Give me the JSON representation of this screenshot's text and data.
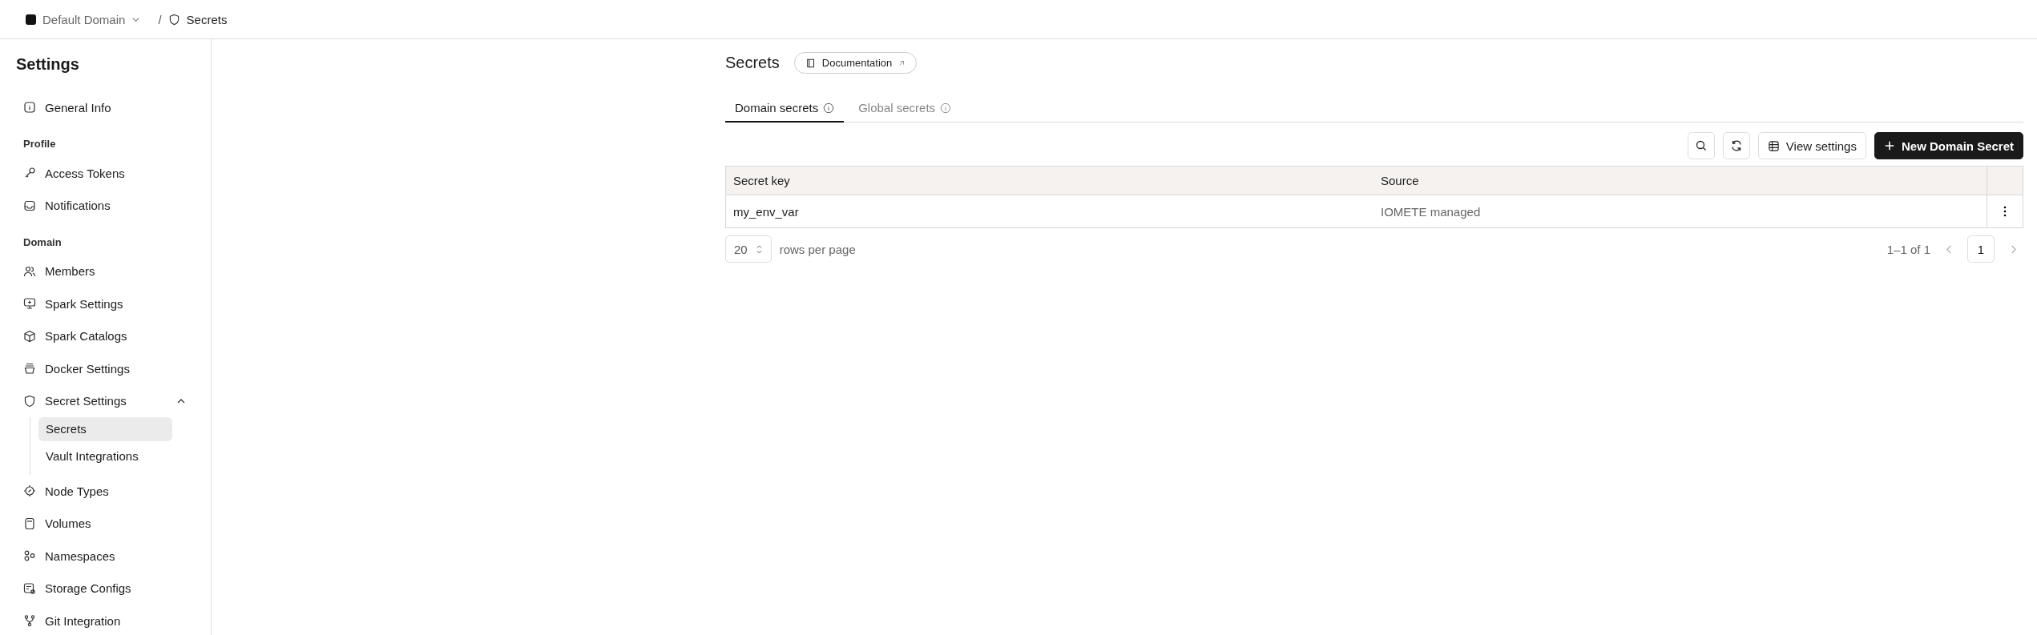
{
  "breadcrumb": {
    "domain": "Default Domain",
    "separator": "/",
    "page": "Secrets"
  },
  "sidebar": {
    "title": "Settings",
    "sections": [
      {
        "items": [
          {
            "label": "General Info",
            "selected": false
          }
        ]
      },
      {
        "heading": "Profile",
        "items": [
          {
            "label": "Access Tokens",
            "selected": false
          },
          {
            "label": "Notifications",
            "selected": false
          }
        ]
      },
      {
        "heading": "Domain",
        "items": [
          {
            "label": "Members",
            "selected": false
          },
          {
            "label": "Spark Settings",
            "selected": false
          },
          {
            "label": "Spark Catalogs",
            "selected": false
          },
          {
            "label": "Docker Settings",
            "selected": false
          },
          {
            "label": "Secret Settings",
            "selected": false,
            "expanded": true,
            "children": [
              {
                "label": "Secrets",
                "selected": true
              },
              {
                "label": "Vault Integrations",
                "selected": false
              }
            ]
          },
          {
            "label": "Node Types",
            "selected": false
          },
          {
            "label": "Volumes",
            "selected": false
          },
          {
            "label": "Namespaces",
            "selected": false
          },
          {
            "label": "Storage Configs",
            "selected": false
          },
          {
            "label": "Git Integration",
            "selected": false
          }
        ]
      }
    ]
  },
  "page": {
    "title": "Secrets",
    "doc_link": "Documentation"
  },
  "tabs": [
    {
      "label": "Domain secrets",
      "selected": true
    },
    {
      "label": "Global secrets",
      "selected": false
    }
  ],
  "toolbar": {
    "view_settings": "View settings",
    "new_button": "New Domain Secret"
  },
  "table": {
    "columns": [
      "Secret key",
      "Source"
    ],
    "rows": [
      [
        "my_env_var",
        "IOMETE managed"
      ]
    ]
  },
  "pagination": {
    "page_size": "20",
    "rows_label": "rows per page",
    "range": "1–1 of 1",
    "pages": [
      {
        "label": "1",
        "selected": true
      }
    ]
  }
}
